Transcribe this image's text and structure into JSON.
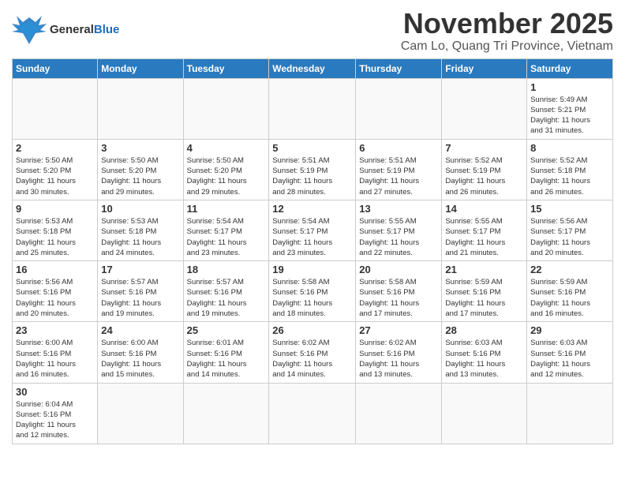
{
  "header": {
    "logo_general": "General",
    "logo_blue": "Blue",
    "title": "November 2025",
    "location": "Cam Lo, Quang Tri Province, Vietnam"
  },
  "weekdays": [
    "Sunday",
    "Monday",
    "Tuesday",
    "Wednesday",
    "Thursday",
    "Friday",
    "Saturday"
  ],
  "days": [
    {
      "num": "",
      "info": ""
    },
    {
      "num": "",
      "info": ""
    },
    {
      "num": "",
      "info": ""
    },
    {
      "num": "",
      "info": ""
    },
    {
      "num": "",
      "info": ""
    },
    {
      "num": "",
      "info": ""
    },
    {
      "num": "1",
      "info": "Sunrise: 5:49 AM\nSunset: 5:21 PM\nDaylight: 11 hours\nand 31 minutes."
    },
    {
      "num": "2",
      "info": "Sunrise: 5:50 AM\nSunset: 5:20 PM\nDaylight: 11 hours\nand 30 minutes."
    },
    {
      "num": "3",
      "info": "Sunrise: 5:50 AM\nSunset: 5:20 PM\nDaylight: 11 hours\nand 29 minutes."
    },
    {
      "num": "4",
      "info": "Sunrise: 5:50 AM\nSunset: 5:20 PM\nDaylight: 11 hours\nand 29 minutes."
    },
    {
      "num": "5",
      "info": "Sunrise: 5:51 AM\nSunset: 5:19 PM\nDaylight: 11 hours\nand 28 minutes."
    },
    {
      "num": "6",
      "info": "Sunrise: 5:51 AM\nSunset: 5:19 PM\nDaylight: 11 hours\nand 27 minutes."
    },
    {
      "num": "7",
      "info": "Sunrise: 5:52 AM\nSunset: 5:19 PM\nDaylight: 11 hours\nand 26 minutes."
    },
    {
      "num": "8",
      "info": "Sunrise: 5:52 AM\nSunset: 5:18 PM\nDaylight: 11 hours\nand 26 minutes."
    },
    {
      "num": "9",
      "info": "Sunrise: 5:53 AM\nSunset: 5:18 PM\nDaylight: 11 hours\nand 25 minutes."
    },
    {
      "num": "10",
      "info": "Sunrise: 5:53 AM\nSunset: 5:18 PM\nDaylight: 11 hours\nand 24 minutes."
    },
    {
      "num": "11",
      "info": "Sunrise: 5:54 AM\nSunset: 5:17 PM\nDaylight: 11 hours\nand 23 minutes."
    },
    {
      "num": "12",
      "info": "Sunrise: 5:54 AM\nSunset: 5:17 PM\nDaylight: 11 hours\nand 23 minutes."
    },
    {
      "num": "13",
      "info": "Sunrise: 5:55 AM\nSunset: 5:17 PM\nDaylight: 11 hours\nand 22 minutes."
    },
    {
      "num": "14",
      "info": "Sunrise: 5:55 AM\nSunset: 5:17 PM\nDaylight: 11 hours\nand 21 minutes."
    },
    {
      "num": "15",
      "info": "Sunrise: 5:56 AM\nSunset: 5:17 PM\nDaylight: 11 hours\nand 20 minutes."
    },
    {
      "num": "16",
      "info": "Sunrise: 5:56 AM\nSunset: 5:16 PM\nDaylight: 11 hours\nand 20 minutes."
    },
    {
      "num": "17",
      "info": "Sunrise: 5:57 AM\nSunset: 5:16 PM\nDaylight: 11 hours\nand 19 minutes."
    },
    {
      "num": "18",
      "info": "Sunrise: 5:57 AM\nSunset: 5:16 PM\nDaylight: 11 hours\nand 19 minutes."
    },
    {
      "num": "19",
      "info": "Sunrise: 5:58 AM\nSunset: 5:16 PM\nDaylight: 11 hours\nand 18 minutes."
    },
    {
      "num": "20",
      "info": "Sunrise: 5:58 AM\nSunset: 5:16 PM\nDaylight: 11 hours\nand 17 minutes."
    },
    {
      "num": "21",
      "info": "Sunrise: 5:59 AM\nSunset: 5:16 PM\nDaylight: 11 hours\nand 17 minutes."
    },
    {
      "num": "22",
      "info": "Sunrise: 5:59 AM\nSunset: 5:16 PM\nDaylight: 11 hours\nand 16 minutes."
    },
    {
      "num": "23",
      "info": "Sunrise: 6:00 AM\nSunset: 5:16 PM\nDaylight: 11 hours\nand 16 minutes."
    },
    {
      "num": "24",
      "info": "Sunrise: 6:00 AM\nSunset: 5:16 PM\nDaylight: 11 hours\nand 15 minutes."
    },
    {
      "num": "25",
      "info": "Sunrise: 6:01 AM\nSunset: 5:16 PM\nDaylight: 11 hours\nand 14 minutes."
    },
    {
      "num": "26",
      "info": "Sunrise: 6:02 AM\nSunset: 5:16 PM\nDaylight: 11 hours\nand 14 minutes."
    },
    {
      "num": "27",
      "info": "Sunrise: 6:02 AM\nSunset: 5:16 PM\nDaylight: 11 hours\nand 13 minutes."
    },
    {
      "num": "28",
      "info": "Sunrise: 6:03 AM\nSunset: 5:16 PM\nDaylight: 11 hours\nand 13 minutes."
    },
    {
      "num": "29",
      "info": "Sunrise: 6:03 AM\nSunset: 5:16 PM\nDaylight: 11 hours\nand 12 minutes."
    },
    {
      "num": "30",
      "info": "Sunrise: 6:04 AM\nSunset: 5:16 PM\nDaylight: 11 hours\nand 12 minutes."
    }
  ]
}
